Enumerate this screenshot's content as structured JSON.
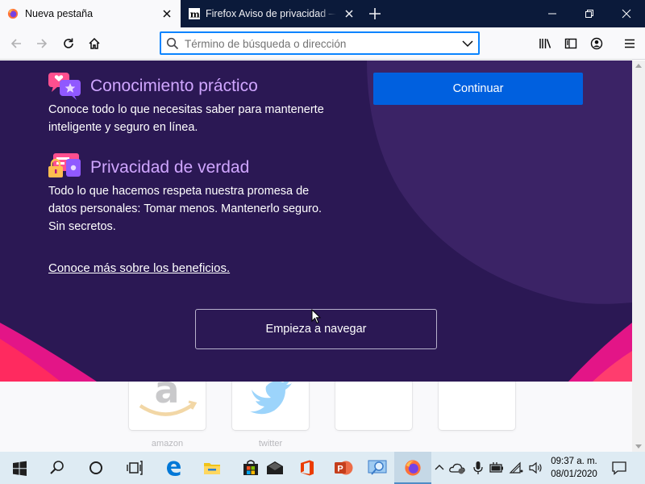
{
  "browser": {
    "tabs": [
      {
        "title": "Nueva pestaña",
        "active": true,
        "favicon": "firefox-icon"
      },
      {
        "title": "Firefox Aviso de privacidad — Mozilla",
        "active": false,
        "favicon": "mozilla-m-icon"
      }
    ],
    "new_tab_icon": "plus-icon",
    "window_controls": [
      "minimize-icon",
      "restore-icon",
      "close-icon"
    ],
    "url_placeholder": "Término de búsqueda o dirección",
    "url_value": "",
    "toolbar_icons": [
      "back-icon",
      "forward-icon",
      "reload-icon",
      "home-icon",
      "library-icon",
      "sidebar-icon",
      "account-icon",
      "menu-icon"
    ]
  },
  "onboarding": {
    "feature_1": {
      "title": "Conocimiento práctico",
      "text_line1": "Conoce todo lo que necesitas saber para mantenerte",
      "text_line2": "inteligente y seguro en línea."
    },
    "feature_2": {
      "title": "Privacidad de verdad",
      "text_line1": "Todo lo que hacemos respeta nuestra promesa de",
      "text_line2": "datos personales: Tomar menos. Mantenerlo seguro.",
      "text_line3": "Sin secretos."
    },
    "learn_more": "Conoce más sobre los beneficios.",
    "continue_button": "Continuar",
    "start_button": "Empieza a navegar",
    "colors": {
      "panel_background": "#2b1854",
      "accent_title": "#d0a6ff",
      "primary_button": "#0060df"
    }
  },
  "top_sites": [
    {
      "label": "amazon",
      "icon": "amazon-logo"
    },
    {
      "label": "twitter",
      "icon": "twitter-bird-logo"
    },
    {
      "label": "",
      "icon": ""
    },
    {
      "label": "",
      "icon": ""
    }
  ],
  "taskbar": {
    "items": [
      "windows-start-icon",
      "search-icon",
      "cortana-icon",
      "task-view-icon",
      "edge-icon",
      "file-explorer-icon",
      "store-icon",
      "mail-icon",
      "office-icon",
      "powerpoint-icon",
      "magnifier-icon",
      "firefox-icon"
    ],
    "tray_icons": [
      "chevron-up-icon",
      "onedrive-icon",
      "microphone-icon",
      "battery-icon",
      "wifi-icon",
      "volume-icon"
    ],
    "time": "09:37 a. m.",
    "date": "08/01/2020"
  }
}
